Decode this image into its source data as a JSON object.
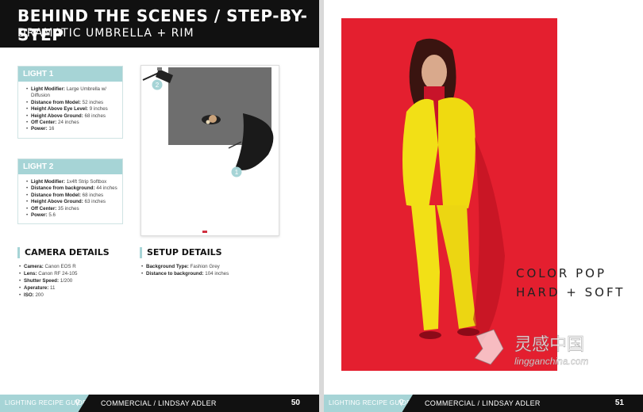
{
  "left_page": {
    "title": "BEHIND THE SCENES / STEP-BY-STEP",
    "subtitle": "DRAMATIC UMBRELLA + RIM",
    "light1": {
      "heading": "LIGHT 1",
      "items": [
        {
          "label": "Light Modifier:",
          "value": "Large Umbrella w/ Diffusion"
        },
        {
          "label": "Distance from Model:",
          "value": "52 inches"
        },
        {
          "label": "Height Above Eye Level:",
          "value": "9 inches"
        },
        {
          "label": "Height Above Ground:",
          "value": "68 inches"
        },
        {
          "label": "Off Center:",
          "value": "24 inches"
        },
        {
          "label": "Power:",
          "value": "16"
        }
      ]
    },
    "light2": {
      "heading": "LIGHT 2",
      "items": [
        {
          "label": "Light Modifier:",
          "value": "1x4ft Strip Softbox"
        },
        {
          "label": "Distance from background:",
          "value": "44 inches"
        },
        {
          "label": "Distance from Model:",
          "value": "68 inches"
        },
        {
          "label": "Height Above Ground:",
          "value": "63 inches"
        },
        {
          "label": "Off Center:",
          "value": "35 inches"
        },
        {
          "label": "Power:",
          "value": "5.6"
        }
      ]
    },
    "diagram": {
      "marker1": "1",
      "marker2": "2"
    },
    "camera": {
      "heading": "CAMERA DETAILS",
      "items": [
        {
          "label": "Camera:",
          "value": "Canon EOS R"
        },
        {
          "label": "Lens:",
          "value": "Canon RF 24-105"
        },
        {
          "label": "Shutter Speed:",
          "value": "1/200"
        },
        {
          "label": "Aperature:",
          "value": "11"
        },
        {
          "label": "ISO:",
          "value": "200"
        }
      ]
    },
    "setup": {
      "heading": "SETUP DETAILS",
      "items": [
        {
          "label": "Background Type:",
          "value": "Fashion Grey"
        },
        {
          "label": "Distance to background:",
          "value": "104 inches"
        }
      ]
    },
    "footer": {
      "guide": "LIGHTING RECIPE GUIDE",
      "author": "COMMERCIAL / LINDSAY ADLER",
      "page": "50"
    }
  },
  "right_page": {
    "overlay_line1": "COLOR POP",
    "overlay_line2": "HARD + SOFT",
    "watermark": {
      "cn": "灵感中国",
      "url": "lingganchina.com"
    },
    "footer": {
      "guide": "LIGHTING RECIPE GUIDE",
      "author": "COMMERCIAL / LINDSAY ADLER",
      "page": "51"
    }
  },
  "colors": {
    "accent": "#a6d4d6",
    "photo_bg": "#e41f2f",
    "suit": "#f2e016",
    "dark": "#111111"
  }
}
